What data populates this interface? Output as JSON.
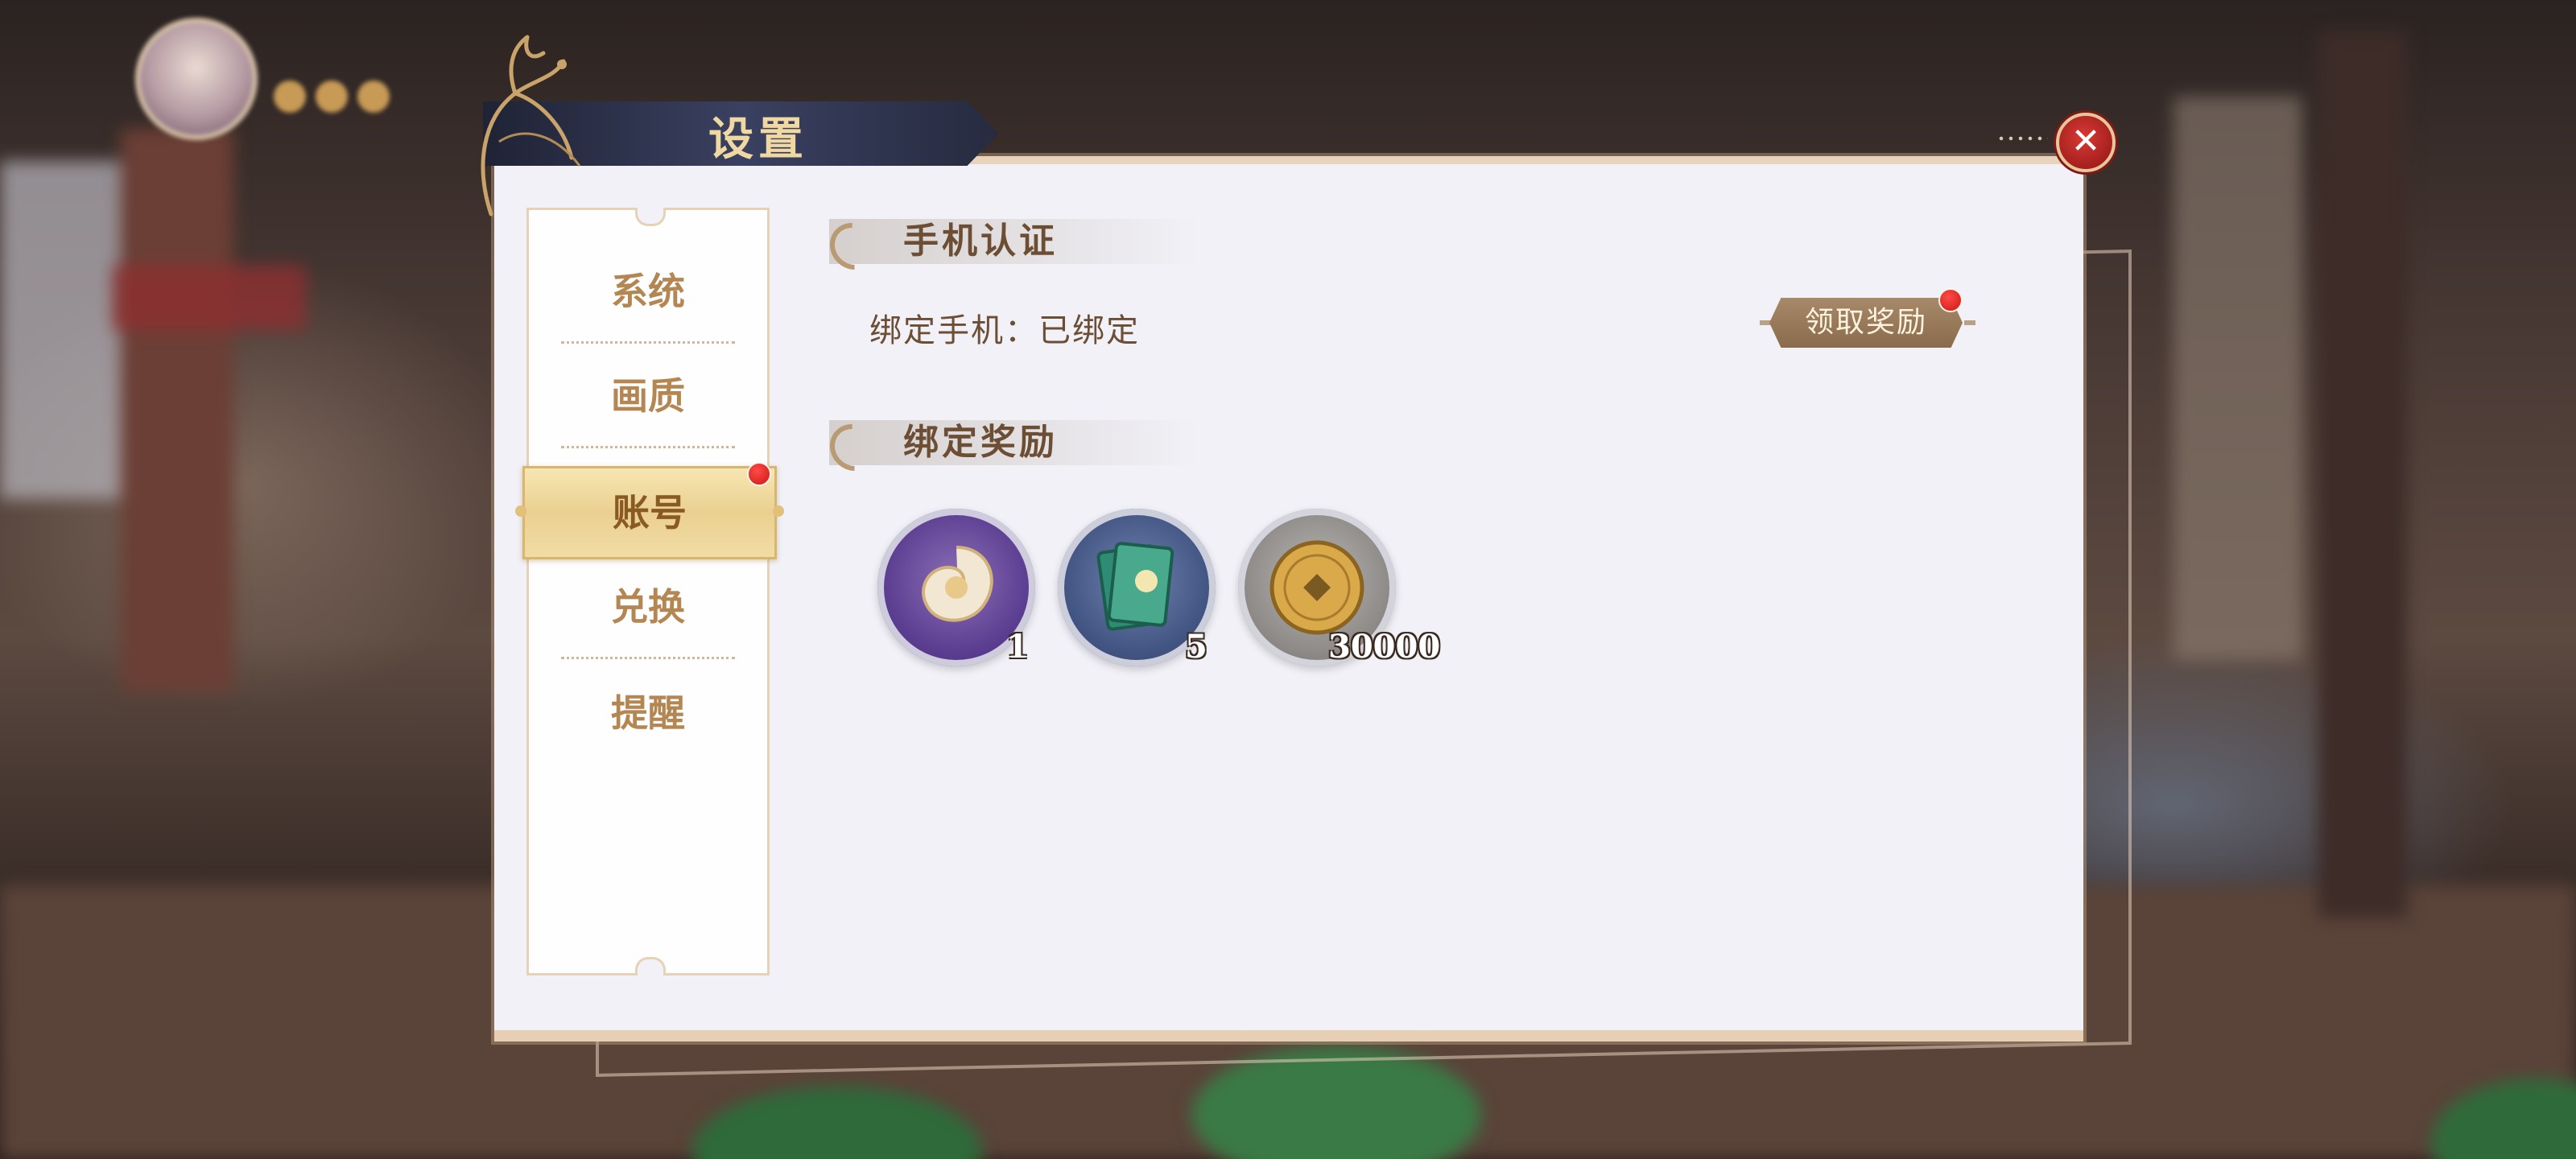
{
  "window": {
    "title": "设置",
    "close_icon": "close-icon"
  },
  "sidebar": {
    "items": [
      {
        "label": "系统",
        "active": false
      },
      {
        "label": "画质",
        "active": false
      },
      {
        "label": "账号",
        "active": true,
        "badge": true
      },
      {
        "label": "兑换",
        "active": false
      },
      {
        "label": "提醒",
        "active": false
      }
    ]
  },
  "phone_auth": {
    "header": "手机认证",
    "bind_status": "绑定手机：已绑定",
    "claim_button": "领取奖励",
    "claim_badge": true
  },
  "bind_rewards": {
    "header": "绑定奖励",
    "items": [
      {
        "icon": "jade-pendant-icon",
        "quantity": "1"
      },
      {
        "icon": "green-book-icon",
        "quantity": "5"
      },
      {
        "icon": "copper-coin-icon",
        "quantity": "30000"
      }
    ]
  },
  "colors": {
    "accent_gold": "#b38652",
    "badge_red": "#cc1815",
    "panel_bg": "#f1f1f7",
    "title_plate": "#262b40"
  }
}
